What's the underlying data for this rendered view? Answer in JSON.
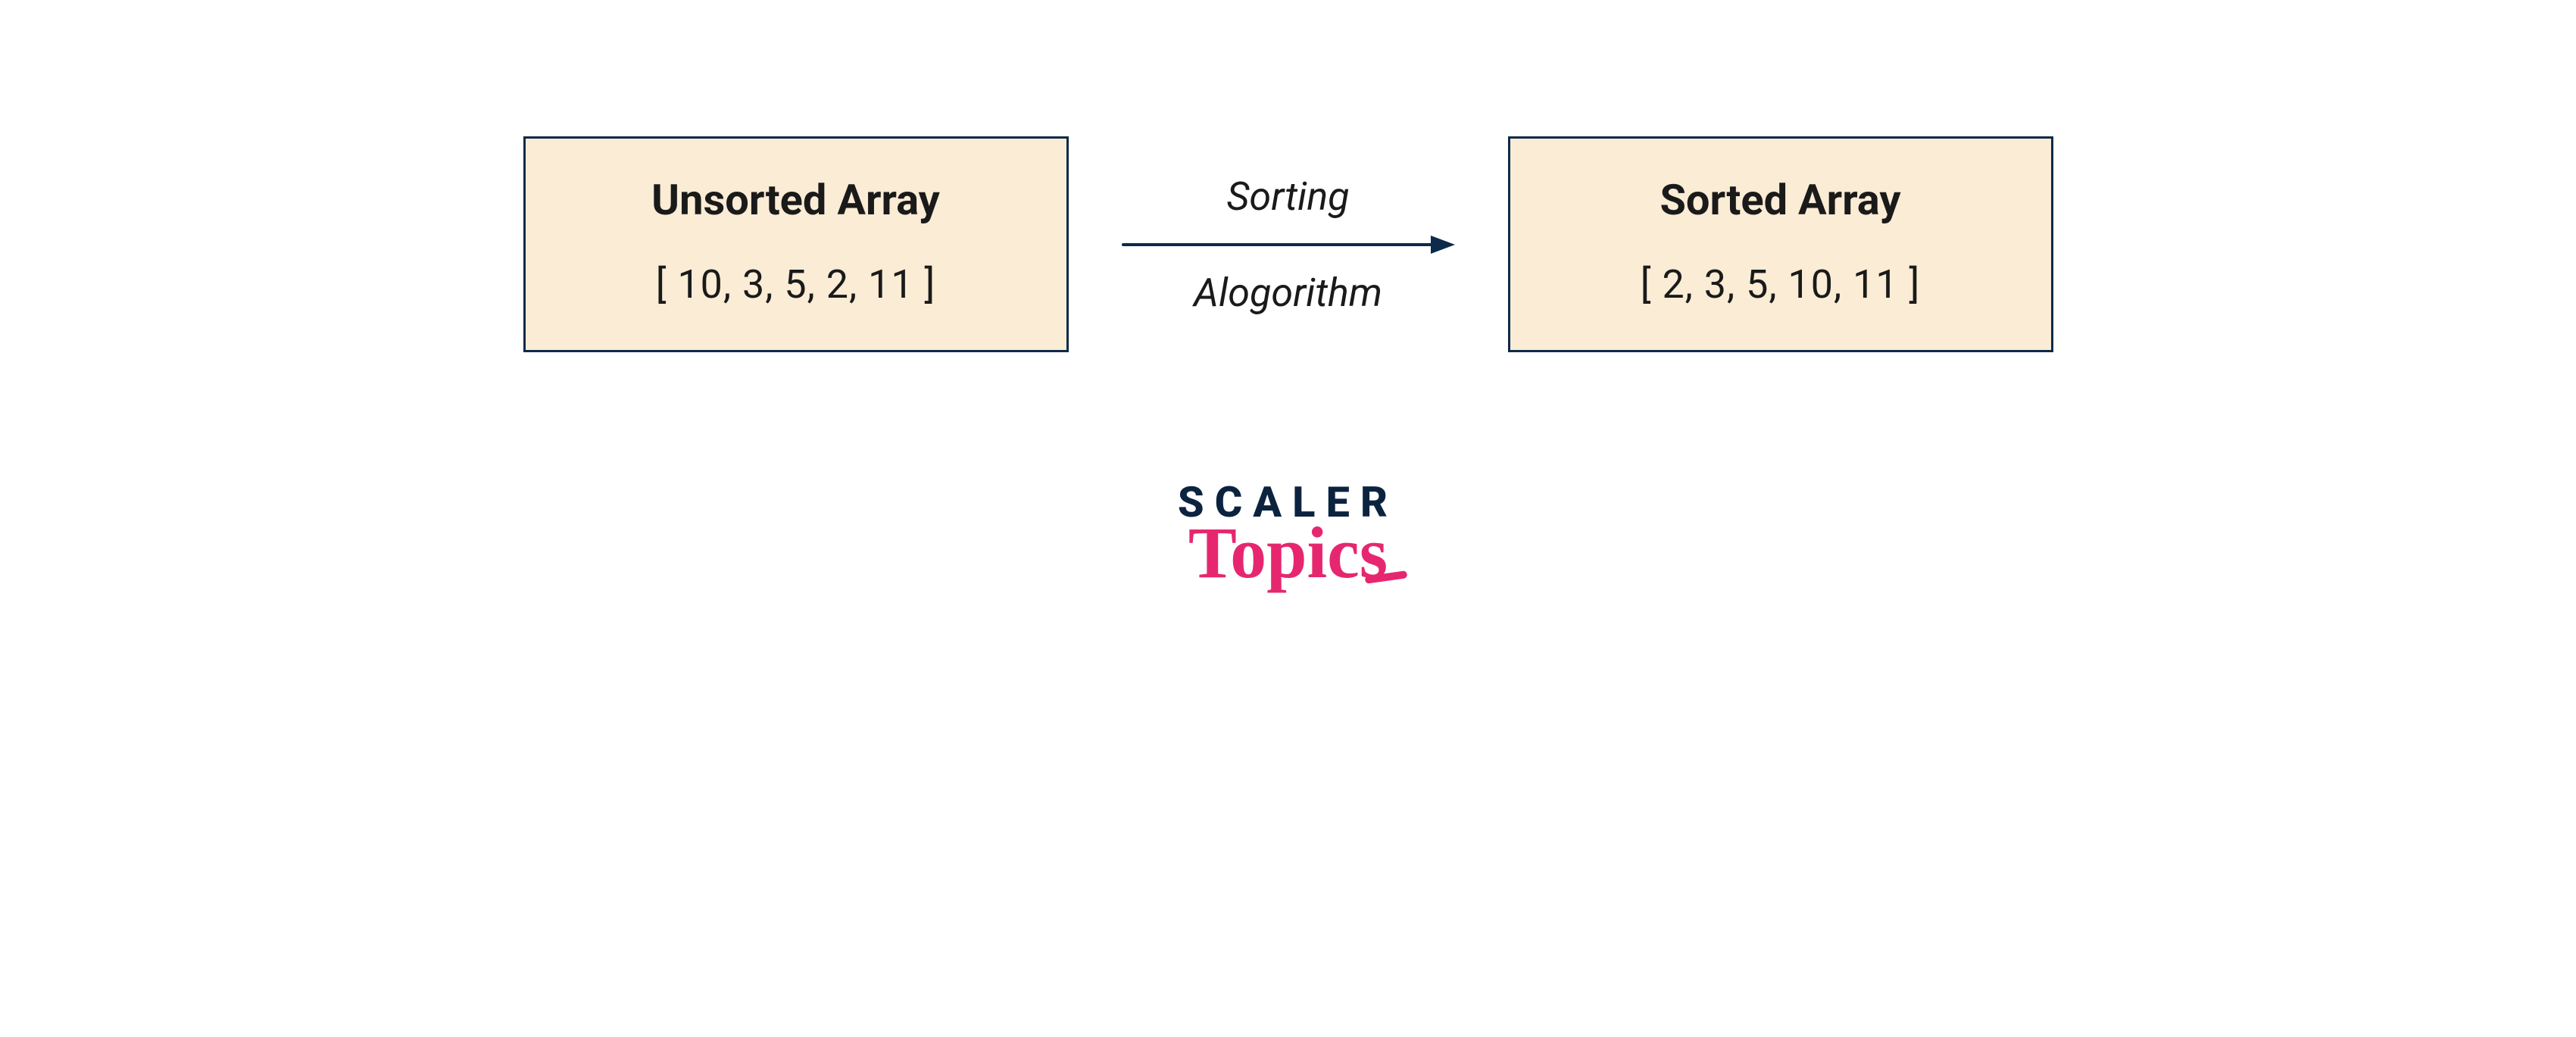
{
  "diagram": {
    "unsorted": {
      "title": "Unsorted Array",
      "content": "[ 10, 3, 5, 2, 11 ]"
    },
    "arrow": {
      "label_top": "Sorting",
      "label_bottom": "Alogorithm"
    },
    "sorted": {
      "title": "Sorted Array",
      "content": "[ 2, 3, 5, 10, 11 ]"
    }
  },
  "brand": {
    "top": "SCALER",
    "bottom": "Topics"
  },
  "colors": {
    "box_fill": "#faecd5",
    "box_border": "#0d2a4a",
    "text": "#1a1a1a",
    "brand_top": "#0c2340",
    "brand_bottom": "#e6276f",
    "arrow": "#0d2a4a"
  }
}
